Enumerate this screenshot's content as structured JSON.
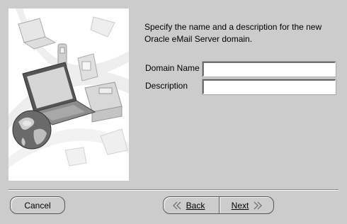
{
  "intro": {
    "line1": "Specify the name and a description for the new",
    "line2": "Oracle eMail Server domain."
  },
  "form": {
    "domain_name_label": "Domain Name",
    "domain_name_value": "",
    "description_label": "Description",
    "description_value": ""
  },
  "buttons": {
    "cancel_label": "Cancel",
    "back_label": "Back",
    "next_label": "Next"
  },
  "icons": {
    "back": "double-chevron-left-icon",
    "next": "double-chevron-right-icon",
    "illustration": "laptop-globe-illustration"
  },
  "colors": {
    "background": "#cccccc",
    "field_background": "#ffffff",
    "border": "#555555"
  }
}
